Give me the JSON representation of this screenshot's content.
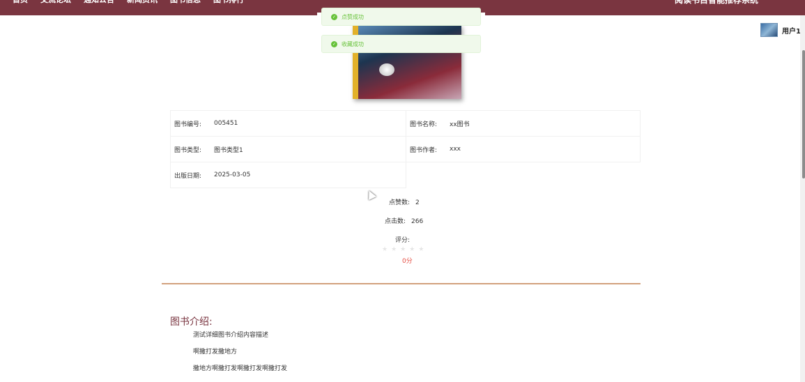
{
  "nav": {
    "items": [
      "首页",
      "交流论坛",
      "通知公告",
      "新闻资讯",
      "图书信息",
      "图书排行"
    ],
    "brand": "阅读书目智能推荐系统"
  },
  "user": {
    "name": "用户1"
  },
  "toasts": [
    {
      "text": "点赞成功"
    },
    {
      "text": "收藏成功"
    }
  ],
  "info": {
    "book_no_label": "图书编号:",
    "book_no": "005451",
    "book_name_label": "图书名称:",
    "book_name": "xx图书",
    "book_type_label": "图书类型:",
    "book_type": "图书类型1",
    "author_label": "图书作者:",
    "author": "xxx",
    "pub_date_label": "出版日期:",
    "pub_date": "2025-03-05"
  },
  "stats": {
    "likes_label": "点赞数:",
    "likes": "2",
    "clicks_label": "点击数:",
    "clicks": "266",
    "rating_label": "评分:",
    "rating_value": 0,
    "rating_max": 5,
    "score_text": "0分"
  },
  "intro": {
    "title": "图书介绍:",
    "lines": [
      "测试详细图书介绍内容描述",
      "啊撒打发撒地方",
      "撒地方啊撒打发啊撒打发啊撒打发"
    ]
  },
  "colors": {
    "header": "#7a3540",
    "success": "#67c23a",
    "score": "#e54d42",
    "divider": "#d2a07c"
  }
}
